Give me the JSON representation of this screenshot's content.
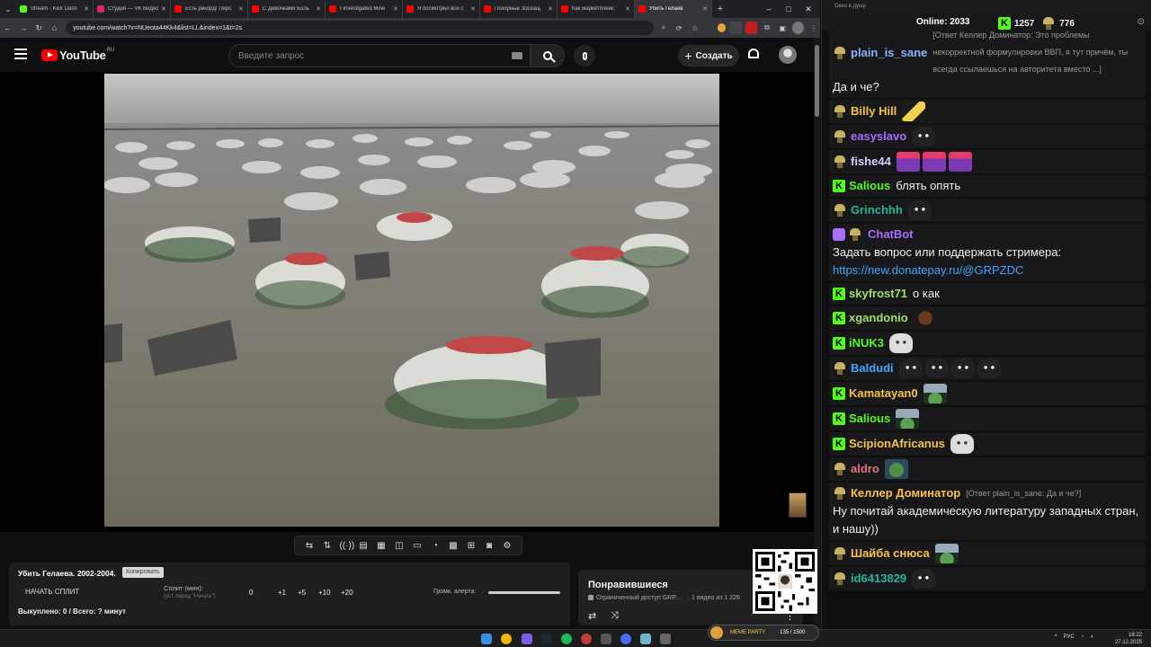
{
  "browser": {
    "tabs": [
      {
        "label": "Stream - Kick Dash",
        "color": "#53fc18",
        "active": false
      },
      {
        "label": "Студия — VK Видео",
        "color": "#e0245e",
        "active": false
      },
      {
        "label": "Есть рекорд! Перс",
        "color": "#ff0000",
        "active": false
      },
      {
        "label": "С Девочками Боль",
        "color": "#ff0000",
        "active": false
      },
      {
        "label": "I Investigated Mine",
        "color": "#ff0000",
        "active": false
      },
      {
        "label": "Я посмотрел все с",
        "color": "#ff0000",
        "active": false
      },
      {
        "label": "Позорные Зоозащ",
        "color": "#ff0000",
        "active": false
      },
      {
        "label": "Как маркетплейс",
        "color": "#ff0000",
        "active": false
      },
      {
        "label": "Убить Гелаев",
        "color": "#ff0000",
        "active": true
      }
    ],
    "url": "youtube.com/watch?v=NUeota44Kk4&list=LL&index=1&t=2s"
  },
  "youtube": {
    "logo_text": "YouTube",
    "region": "RU",
    "search_placeholder": "Введите запрос",
    "create_label": "Создать"
  },
  "split": {
    "title": "Убить Гелаева. 2002-2004.",
    "copy_label": "Копировать",
    "start_label": "НАЧАТЬ СПЛИТ",
    "split_label": "Сплит (мин):",
    "split_sub": "(уст. перед \"Начать\")",
    "values": [
      "0",
      "+1",
      "+5",
      "+10",
      "+20"
    ],
    "alert_label": "Громк. алерта:",
    "bought": "Выкуплено: 0 / Всего: ? минут"
  },
  "liked": {
    "title": "Понравившиеся",
    "subtitle": "Ограниченный доступ GRP...",
    "count": "· 1 видео из 1 226"
  },
  "memeparty": {
    "label": "MEME PARTY",
    "count": "135 / 1500"
  },
  "chat": {
    "window_title": "Окно в душу",
    "online_label": "Online:",
    "online_count": "2033",
    "kick_points": "1257",
    "crown_points": "776",
    "messages": [
      {
        "name": "plain_is_sane",
        "color": "#8ab4ff",
        "badge": "crown",
        "reply": "[Ответ Келлер Доминатор: Это проблемы некорректной формулировки ВВП, я тут причём, ты всегда ссылаешься на авторитета вместо ...]",
        "text": "Да и че?",
        "emotes": []
      },
      {
        "name": "Billy Hill",
        "color": "#f6c343",
        "badge": "crown",
        "text": "",
        "emotes": [
          "hat"
        ]
      },
      {
        "name": "easyslavo",
        "color": "#a970ff",
        "badge": "crown",
        "text": "",
        "emotes": [
          "cat"
        ]
      },
      {
        "name": "fishe44",
        "color": "#d0d0ff",
        "badge": "crown",
        "text": "",
        "emotes": [
          "pink",
          "pink",
          "pink"
        ]
      },
      {
        "name": "Salious",
        "color": "#53fc18",
        "badge": "kick",
        "text": "блять опять",
        "emotes": []
      },
      {
        "name": "Grinchhh",
        "color": "#22b59a",
        "badge": "crown",
        "text": "",
        "emotes": [
          "cat"
        ]
      },
      {
        "name": "ChatBot",
        "color": "#a970ff",
        "badge": "bot",
        "text": "Задать вопрос или поддержать стримера:",
        "link": "https://new.donatepay.ru/@GRPZDC",
        "emotes": []
      },
      {
        "name": "skyfrost71",
        "color": "#9de06a",
        "badge": "kick",
        "text": "о как",
        "emotes": []
      },
      {
        "name": "xgandonio",
        "color": "#9de06a",
        "badge": "kick",
        "text": "",
        "emotes": [
          "brown"
        ]
      },
      {
        "name": "iNUK3",
        "color": "#53fc18",
        "badge": "kick",
        "text": "",
        "emotes": [
          "catw"
        ]
      },
      {
        "name": "Baldudi",
        "color": "#3ea6ff",
        "badge": "crown",
        "text": "",
        "emotes": [
          "cat",
          "cat",
          "cat",
          "cat"
        ]
      },
      {
        "name": "Kamatayan0",
        "color": "#f6c343",
        "badge": "kick",
        "text": "",
        "emotes": [
          "umb"
        ]
      },
      {
        "name": "Salious",
        "color": "#53fc18",
        "badge": "kick",
        "text": "",
        "emotes": [
          "umb"
        ]
      },
      {
        "name": "ScipionAfricanus",
        "color": "#f6c343",
        "badge": "kick",
        "text": "",
        "emotes": [
          "catw"
        ]
      },
      {
        "name": "aldro",
        "color": "#e87080",
        "badge": "crown",
        "text": "",
        "emotes": [
          "pepeg"
        ]
      },
      {
        "name": "Келлер Доминатор",
        "color": "#f6c343",
        "badge": "crown",
        "reply": "[Ответ plain_is_sane: Да и че?]",
        "text": "Ну почитай академическую литературу западных стран, и нашу))",
        "emotes": []
      },
      {
        "name": "Шайба снюса",
        "color": "#f6c343",
        "badge": "crown",
        "text": "",
        "emotes": [
          "umb"
        ]
      },
      {
        "name": "id6413829",
        "color": "#22b59a",
        "badge": "crown",
        "text": "",
        "emotes": [
          "cat"
        ]
      }
    ]
  },
  "taskbar": {
    "lang": "РУС",
    "time": "18:22",
    "date": "27.12.2025"
  }
}
